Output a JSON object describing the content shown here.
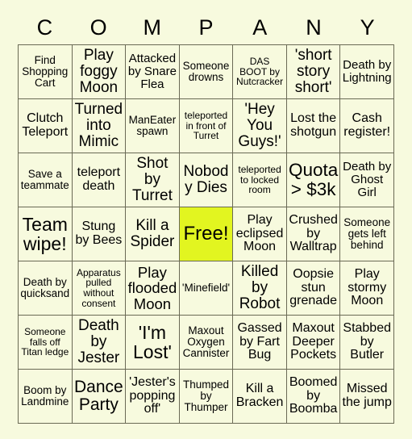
{
  "card": {
    "title_letters": [
      "C",
      "O",
      "M",
      "P",
      "A",
      "N",
      "Y"
    ],
    "background_color": "#f7fade",
    "grid_line_color": "#6a6a55",
    "free_cell_color": "#e2f520",
    "text_color": "#000000",
    "columns": 7,
    "rows": 7,
    "cells": [
      {
        "text": "Find Shopping Cart",
        "size": "sm",
        "free": false
      },
      {
        "text": "Play foggy Moon",
        "size": "lg",
        "free": false
      },
      {
        "text": "Attacked by Snare Flea",
        "size": "md",
        "free": false
      },
      {
        "text": "Someone drowns",
        "size": "sm",
        "free": false
      },
      {
        "text": "DAS BOOT by Nutcracker",
        "size": "xs",
        "free": false
      },
      {
        "text": "'short story short'",
        "size": "lg",
        "free": false
      },
      {
        "text": "Death by Lightning",
        "size": "md",
        "free": false
      },
      {
        "text": "Clutch Teleport",
        "size": "md",
        "free": false
      },
      {
        "text": "Turned into Mimic",
        "size": "lg",
        "free": false
      },
      {
        "text": "ManEater spawn",
        "size": "sm",
        "free": false
      },
      {
        "text": "teleported in front of Turret",
        "size": "xs",
        "free": false
      },
      {
        "text": "'Hey You Guys!'",
        "size": "lg",
        "free": false
      },
      {
        "text": "Lost the shotgun",
        "size": "md",
        "free": false
      },
      {
        "text": "Cash register!",
        "size": "md",
        "free": false
      },
      {
        "text": "Save a teammate",
        "size": "sm",
        "free": false
      },
      {
        "text": "teleport death",
        "size": "md",
        "free": false
      },
      {
        "text": "Shot by Turret",
        "size": "lg",
        "free": false
      },
      {
        "text": "Nobody Dies",
        "size": "lg",
        "free": false
      },
      {
        "text": "teleported to locked room",
        "size": "xs",
        "free": false
      },
      {
        "text": "Quota > $3k",
        "size": "xl",
        "free": false
      },
      {
        "text": "Death by Ghost Girl",
        "size": "md",
        "free": false
      },
      {
        "text": "Team wipe!",
        "size": "xl",
        "free": false
      },
      {
        "text": "Stung by Bees",
        "size": "md",
        "free": false
      },
      {
        "text": "Kill a Spider",
        "size": "lg",
        "free": false
      },
      {
        "text": "Free!",
        "size": "xl",
        "free": true
      },
      {
        "text": "Play eclipsed Moon",
        "size": "md",
        "free": false
      },
      {
        "text": "Crushed by Walltrap",
        "size": "md",
        "free": false
      },
      {
        "text": "Someone gets left behind",
        "size": "sm",
        "free": false
      },
      {
        "text": "Death by quicksand",
        "size": "sm",
        "free": false
      },
      {
        "text": "Apparatus pulled without consent",
        "size": "xs",
        "free": false
      },
      {
        "text": "Play flooded Moon",
        "size": "lg",
        "free": false
      },
      {
        "text": "'Minefield'",
        "size": "sm",
        "free": false
      },
      {
        "text": "Killed by Robot",
        "size": "lg",
        "free": false
      },
      {
        "text": "Oopsie stun grenade",
        "size": "md",
        "free": false
      },
      {
        "text": "Play stormy Moon",
        "size": "md",
        "free": false
      },
      {
        "text": "Someone falls off Titan ledge",
        "size": "xs",
        "free": false
      },
      {
        "text": "Death by Jester",
        "size": "lg",
        "free": false
      },
      {
        "text": "'I'm Lost'",
        "size": "xl",
        "free": false
      },
      {
        "text": "Maxout Oxygen Cannister",
        "size": "sm",
        "free": false
      },
      {
        "text": "Gassed by Fart Bug",
        "size": "md",
        "free": false
      },
      {
        "text": "Maxout Deeper Pockets",
        "size": "md",
        "free": false
      },
      {
        "text": "Stabbed by Butler",
        "size": "md",
        "free": false
      },
      {
        "text": "Boom by Landmine",
        "size": "sm",
        "free": false
      },
      {
        "text": "Dance Party",
        "size": "xl",
        "free": false
      },
      {
        "text": "'Jester's popping off'",
        "size": "md",
        "free": false
      },
      {
        "text": "Thumped by Thumper",
        "size": "sm",
        "free": false
      },
      {
        "text": "Kill a Bracken",
        "size": "md",
        "free": false
      },
      {
        "text": "Boomed by Boomba",
        "size": "md",
        "free": false
      },
      {
        "text": "Missed the jump",
        "size": "md",
        "free": false
      }
    ]
  }
}
